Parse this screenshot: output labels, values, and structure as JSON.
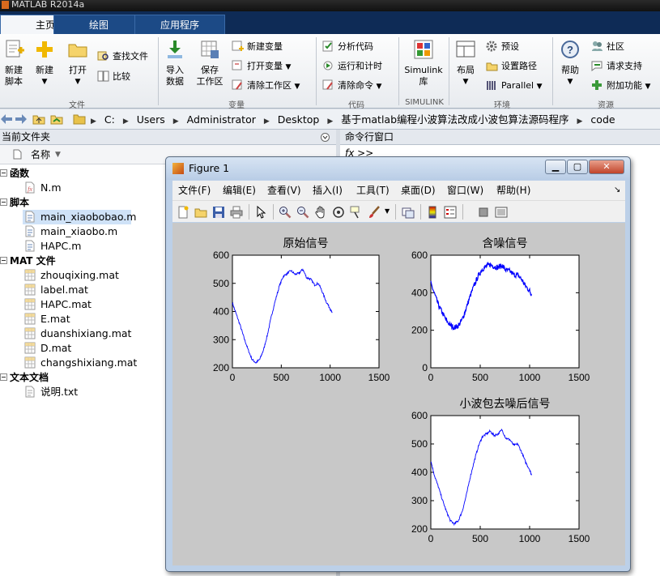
{
  "app": {
    "title": "MATLAB R2014a"
  },
  "tabs": [
    {
      "label": "主页"
    },
    {
      "label": "绘图"
    },
    {
      "label": "应用程序"
    }
  ],
  "ribbon": {
    "file": {
      "new_script": [
        "新建",
        "脚本"
      ],
      "new": "新建",
      "open": "打开",
      "find_files": "查找文件",
      "compare": "比较",
      "group": "文件"
    },
    "variable": {
      "import": [
        "导入",
        "数据"
      ],
      "save": [
        "保存",
        "工作区"
      ],
      "new_var": "新建变量",
      "open_var": "打开变量",
      "clear_ws": "清除工作区",
      "group": "变量"
    },
    "code": {
      "analyze": "分析代码",
      "run_time": "运行和计时",
      "clear_cmd": "清除命令",
      "group": "代码"
    },
    "simulink": {
      "label": [
        "Simulink",
        "库"
      ],
      "group": "SIMULINK"
    },
    "env": {
      "layout": "布局",
      "prefs": "预设",
      "set_path": "设置路径",
      "parallel": "Parallel",
      "group": "环境"
    },
    "resources": {
      "help": "帮助",
      "community": "社区",
      "support": "请求支持",
      "addons": "附加功能",
      "group": "资源"
    }
  },
  "path": [
    "C:",
    "Users",
    "Administrator",
    "Desktop",
    "基于matlab编程小波算法改成小波包算法源码程序",
    "code"
  ],
  "current_folder": {
    "title": "当前文件夹",
    "column": "名称",
    "groups": [
      {
        "name": "函数",
        "files": [
          "N.m"
        ]
      },
      {
        "name": "脚本",
        "files": [
          "main_xiaobobao.m",
          "main_xiaobo.m",
          "HAPC.m"
        ]
      },
      {
        "name": "MAT 文件",
        "files": [
          "zhouqixing.mat",
          "label.mat",
          "HAPC.mat",
          "E.mat",
          "duanshixiang.mat",
          "D.mat",
          "changshixiang.mat"
        ]
      },
      {
        "name": "文本文档",
        "files": [
          "说明.txt"
        ]
      }
    ],
    "selected": "main_xiaobobao.m"
  },
  "command_window": {
    "title": "命令行窗口",
    "prompt": "fx >>"
  },
  "figure": {
    "title": "Figure 1",
    "menus": [
      "文件(F)",
      "编辑(E)",
      "查看(V)",
      "插入(I)",
      "工具(T)",
      "桌面(D)",
      "窗口(W)",
      "帮助(H)"
    ]
  },
  "colors": {
    "line": "#0000ff",
    "canvas": "#c8c8c8",
    "tab_bar": "#0e2b56"
  },
  "chart_data": [
    {
      "type": "line",
      "title": "原始信号",
      "xlim": [
        0,
        1500
      ],
      "ylim": [
        200,
        600
      ],
      "xticks": [
        0,
        500,
        1000,
        1500
      ],
      "yticks": [
        200,
        300,
        400,
        500,
        600
      ],
      "series": [
        {
          "x": [
            0,
            40,
            80,
            120,
            160,
            200,
            240,
            280,
            320,
            360,
            400,
            440,
            480,
            520,
            560,
            600,
            640,
            680,
            720,
            760,
            800,
            840,
            880,
            920,
            960,
            1000,
            1020
          ],
          "values": [
            430,
            390,
            350,
            305,
            265,
            230,
            218,
            230,
            265,
            320,
            385,
            440,
            490,
            525,
            535,
            545,
            532,
            535,
            550,
            520,
            515,
            495,
            500,
            470,
            435,
            410,
            395
          ]
        }
      ]
    },
    {
      "type": "line",
      "title": "含噪信号",
      "xlim": [
        0,
        1500
      ],
      "ylim": [
        0,
        600
      ],
      "xticks": [
        0,
        500,
        1000,
        1500
      ],
      "yticks": [
        0,
        200,
        400,
        600
      ],
      "series": [
        {
          "x": [
            0,
            40,
            80,
            120,
            160,
            200,
            240,
            280,
            320,
            360,
            400,
            440,
            480,
            520,
            560,
            600,
            640,
            680,
            720,
            760,
            800,
            840,
            880,
            920,
            960,
            1000,
            1020
          ],
          "values": [
            450,
            390,
            330,
            290,
            250,
            225,
            215,
            225,
            260,
            320,
            385,
            440,
            490,
            525,
            540,
            550,
            540,
            535,
            545,
            520,
            515,
            495,
            495,
            470,
            435,
            410,
            390
          ]
        }
      ]
    },
    {
      "type": "line",
      "title": "小波包去噪后信号",
      "xlim": [
        0,
        1500
      ],
      "ylim": [
        200,
        600
      ],
      "xticks": [
        0,
        500,
        1000,
        1500
      ],
      "yticks": [
        200,
        300,
        400,
        500,
        600
      ],
      "series": [
        {
          "x": [
            0,
            40,
            80,
            120,
            160,
            200,
            240,
            280,
            320,
            360,
            400,
            440,
            480,
            520,
            560,
            600,
            640,
            680,
            720,
            760,
            800,
            840,
            880,
            920,
            960,
            1000,
            1020
          ],
          "values": [
            440,
            385,
            345,
            300,
            260,
            228,
            218,
            230,
            265,
            320,
            385,
            440,
            490,
            525,
            535,
            545,
            530,
            535,
            550,
            520,
            515,
            495,
            500,
            470,
            435,
            410,
            390
          ]
        }
      ]
    }
  ]
}
